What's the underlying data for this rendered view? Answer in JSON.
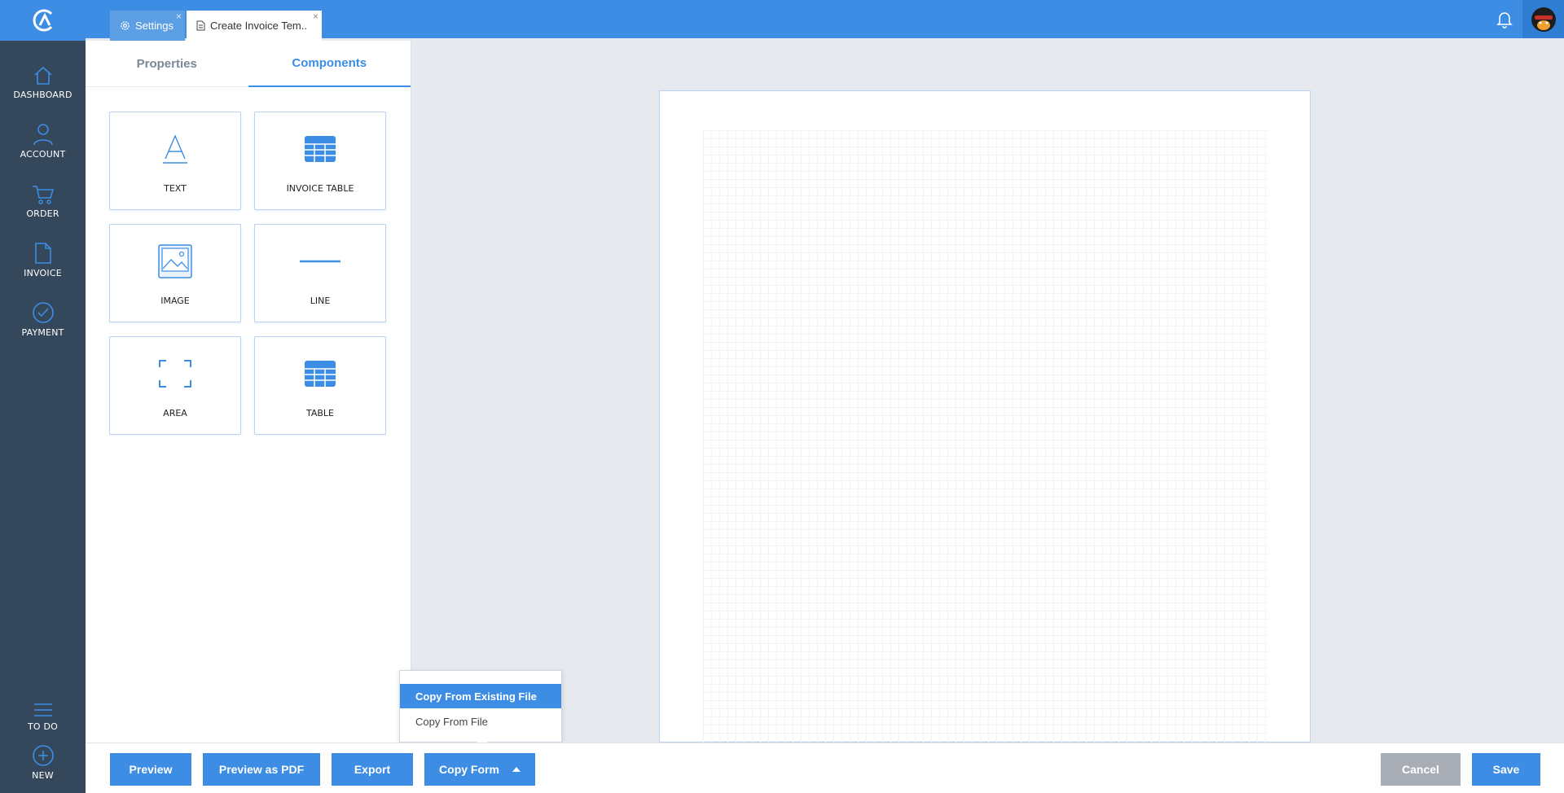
{
  "sidebar": {
    "items": [
      {
        "label": "DASHBOARD",
        "icon": "home-icon"
      },
      {
        "label": "ACCOUNT",
        "icon": "user-icon"
      },
      {
        "label": "ORDER",
        "icon": "cart-icon"
      },
      {
        "label": "INVOICE",
        "icon": "document-icon"
      },
      {
        "label": "PAYMENT",
        "icon": "check-circle-icon"
      }
    ],
    "bottom_items": [
      {
        "label": "TO DO",
        "icon": "list-icon"
      },
      {
        "label": "NEW",
        "icon": "plus-circle-icon"
      }
    ]
  },
  "tabs": [
    {
      "label": "Settings",
      "icon": "gear-icon",
      "close": "×"
    },
    {
      "label": "Create Invoice Tem..",
      "icon": "document-icon",
      "close": "×"
    }
  ],
  "panel": {
    "tabs": [
      {
        "label": "Properties",
        "active": false
      },
      {
        "label": "Components",
        "active": true
      }
    ],
    "components": [
      {
        "label": "TEXT",
        "icon": "text-icon"
      },
      {
        "label": "INVOICE TABLE",
        "icon": "grid-table-icon"
      },
      {
        "label": "IMAGE",
        "icon": "image-icon"
      },
      {
        "label": "LINE",
        "icon": "line-icon"
      },
      {
        "label": "AREA",
        "icon": "area-icon"
      },
      {
        "label": "TABLE",
        "icon": "grid-table-icon"
      }
    ]
  },
  "toolbar": {
    "preview": "Preview",
    "preview_pdf": "Preview as PDF",
    "export": "Export",
    "copy_form": "Copy Form",
    "cancel": "Cancel",
    "save": "Save"
  },
  "copy_form_menu": {
    "items": [
      {
        "label": "Copy From Existing File",
        "selected": true
      },
      {
        "label": "Copy From File",
        "selected": false
      }
    ]
  },
  "colors": {
    "accent": "#3c8de3",
    "sidebar": "#35475b",
    "cancel": "#a9aeb6"
  }
}
